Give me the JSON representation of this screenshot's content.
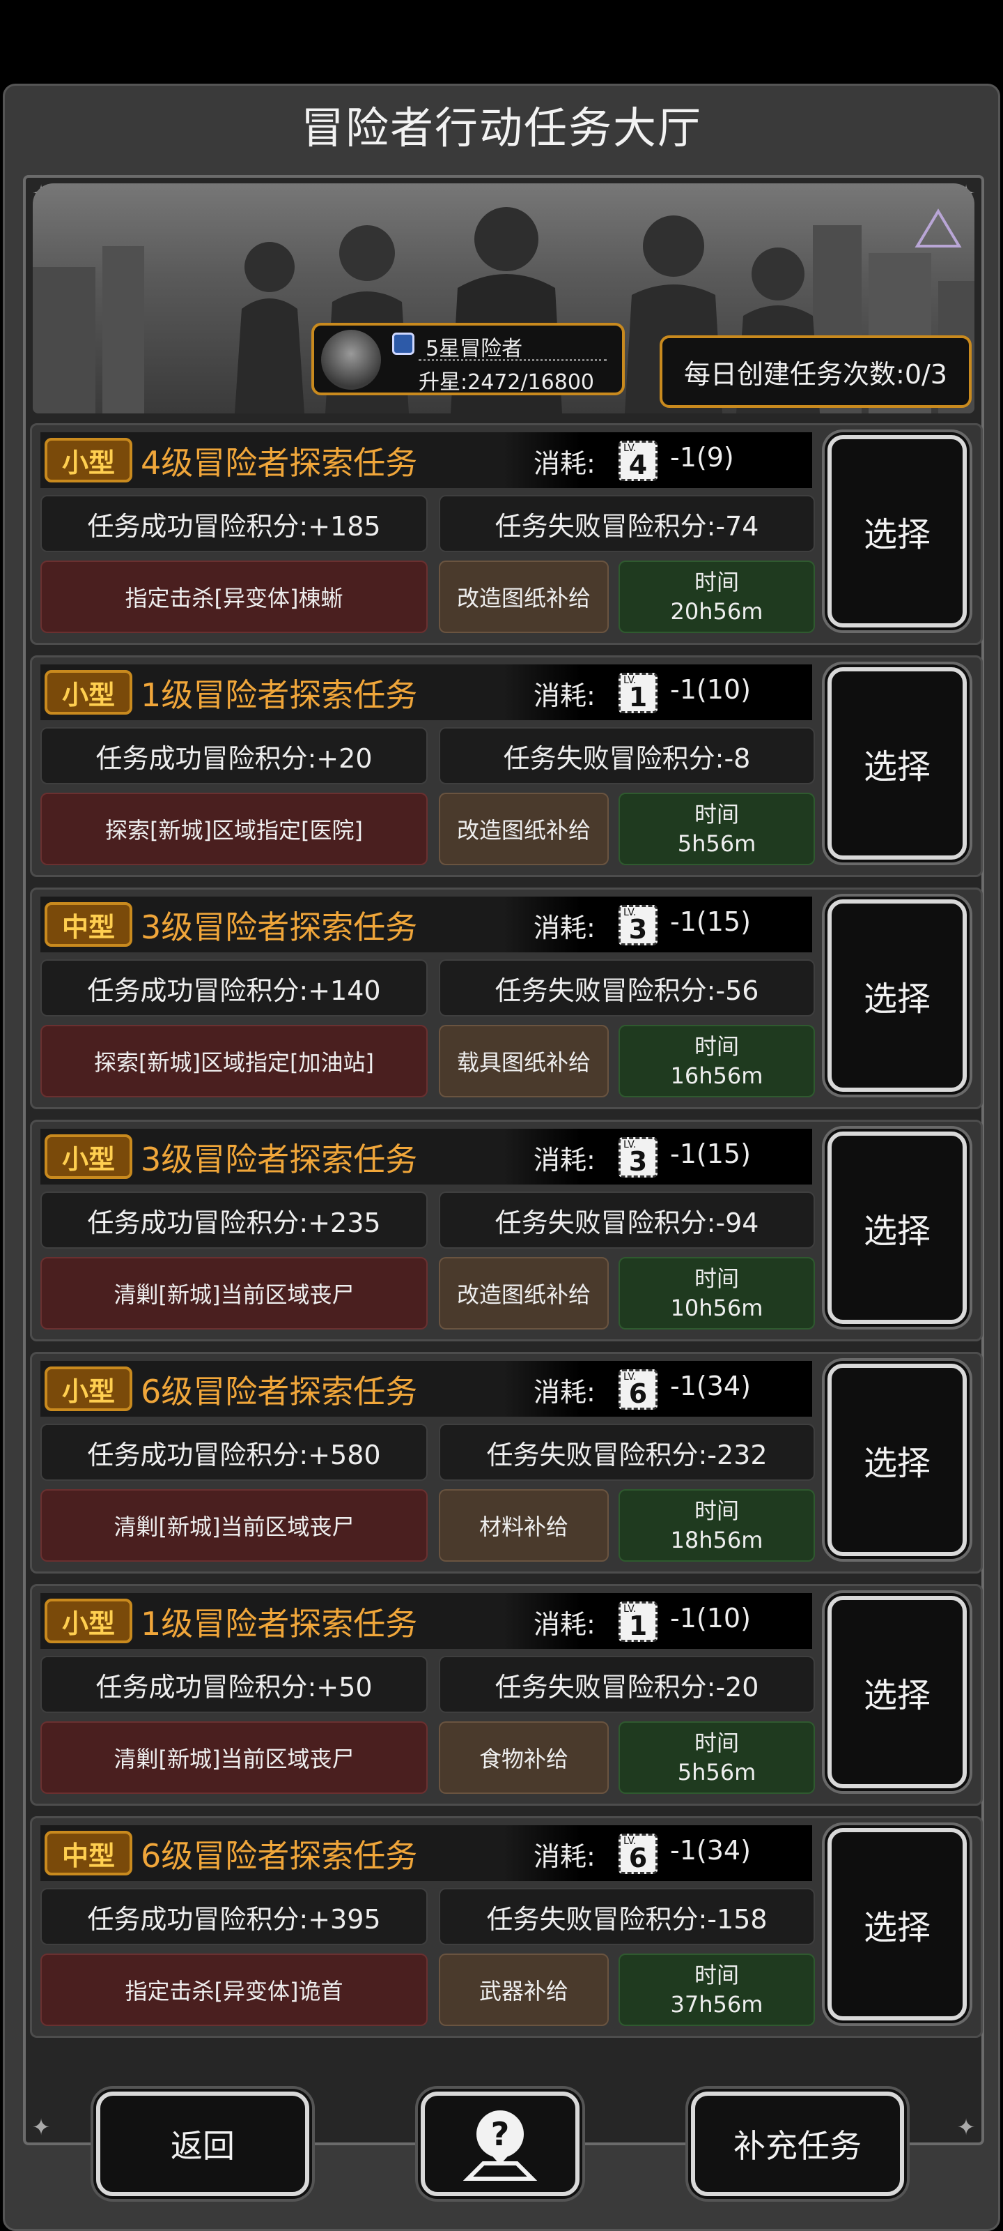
{
  "header": {
    "title": "冒险者行动任务大厅"
  },
  "banner": {
    "rank_title": "5星冒险者",
    "rank_progress": "升星:2472/16800",
    "daily_create": "每日创建任务次数:0/3"
  },
  "tasks": [
    {
      "size": "小型",
      "name": "4级冒险者探索任务",
      "cost_label": "消耗:",
      "card_level": "4",
      "card_prefix": "LV.",
      "cost_value": "-1(9)",
      "success": "任务成功冒险积分:+185",
      "fail": "任务失败冒险积分:-74",
      "target": "指定击杀[异变体]棟蜥",
      "reward": "改造图纸补给",
      "time_label": "时间",
      "time_value": "20h56m",
      "select": "选择"
    },
    {
      "size": "小型",
      "name": "1级冒险者探索任务",
      "cost_label": "消耗:",
      "card_level": "1",
      "card_prefix": "LV.",
      "cost_value": "-1(10)",
      "success": "任务成功冒险积分:+20",
      "fail": "任务失败冒险积分:-8",
      "target": "探索[新城]区域指定[医院]",
      "reward": "改造图纸补给",
      "time_label": "时间",
      "time_value": "5h56m",
      "select": "选择"
    },
    {
      "size": "中型",
      "name": "3级冒险者探索任务",
      "cost_label": "消耗:",
      "card_level": "3",
      "card_prefix": "LV.",
      "cost_value": "-1(15)",
      "success": "任务成功冒险积分:+140",
      "fail": "任务失败冒险积分:-56",
      "target": "探索[新城]区域指定[加油站]",
      "reward": "载具图纸补给",
      "time_label": "时间",
      "time_value": "16h56m",
      "select": "选择"
    },
    {
      "size": "小型",
      "name": "3级冒险者探索任务",
      "cost_label": "消耗:",
      "card_level": "3",
      "card_prefix": "LV.",
      "cost_value": "-1(15)",
      "success": "任务成功冒险积分:+235",
      "fail": "任务失败冒险积分:-94",
      "target": "清剿[新城]当前区域丧尸",
      "reward": "改造图纸补给",
      "time_label": "时间",
      "time_value": "10h56m",
      "select": "选择"
    },
    {
      "size": "小型",
      "name": "6级冒险者探索任务",
      "cost_label": "消耗:",
      "card_level": "6",
      "card_prefix": "LV.",
      "cost_value": "-1(34)",
      "success": "任务成功冒险积分:+580",
      "fail": "任务失败冒险积分:-232",
      "target": "清剿[新城]当前区域丧尸",
      "reward": "材料补给",
      "time_label": "时间",
      "time_value": "18h56m",
      "select": "选择"
    },
    {
      "size": "小型",
      "name": "1级冒险者探索任务",
      "cost_label": "消耗:",
      "card_level": "1",
      "card_prefix": "LV.",
      "cost_value": "-1(10)",
      "success": "任务成功冒险积分:+50",
      "fail": "任务失败冒险积分:-20",
      "target": "清剿[新城]当前区域丧尸",
      "reward": "食物补给",
      "time_label": "时间",
      "time_value": "5h56m",
      "select": "选择"
    },
    {
      "size": "中型",
      "name": "6级冒险者探索任务",
      "cost_label": "消耗:",
      "card_level": "6",
      "card_prefix": "LV.",
      "cost_value": "-1(34)",
      "success": "任务成功冒险积分:+395",
      "fail": "任务失败冒险积分:-158",
      "target": "指定击杀[异变体]诡首",
      "reward": "武器补给",
      "time_label": "时间",
      "time_value": "37h56m",
      "select": "选择"
    }
  ],
  "footer": {
    "back": "返回",
    "help_icon": "help-map-icon",
    "refill": "补充任务"
  },
  "colors": {
    "accent": "#c98a1e",
    "task_name": "#f0a63a",
    "target_bg": "#4a1f1f",
    "reward_bg": "#4a3a2c",
    "time_bg": "#1f3a1f"
  }
}
